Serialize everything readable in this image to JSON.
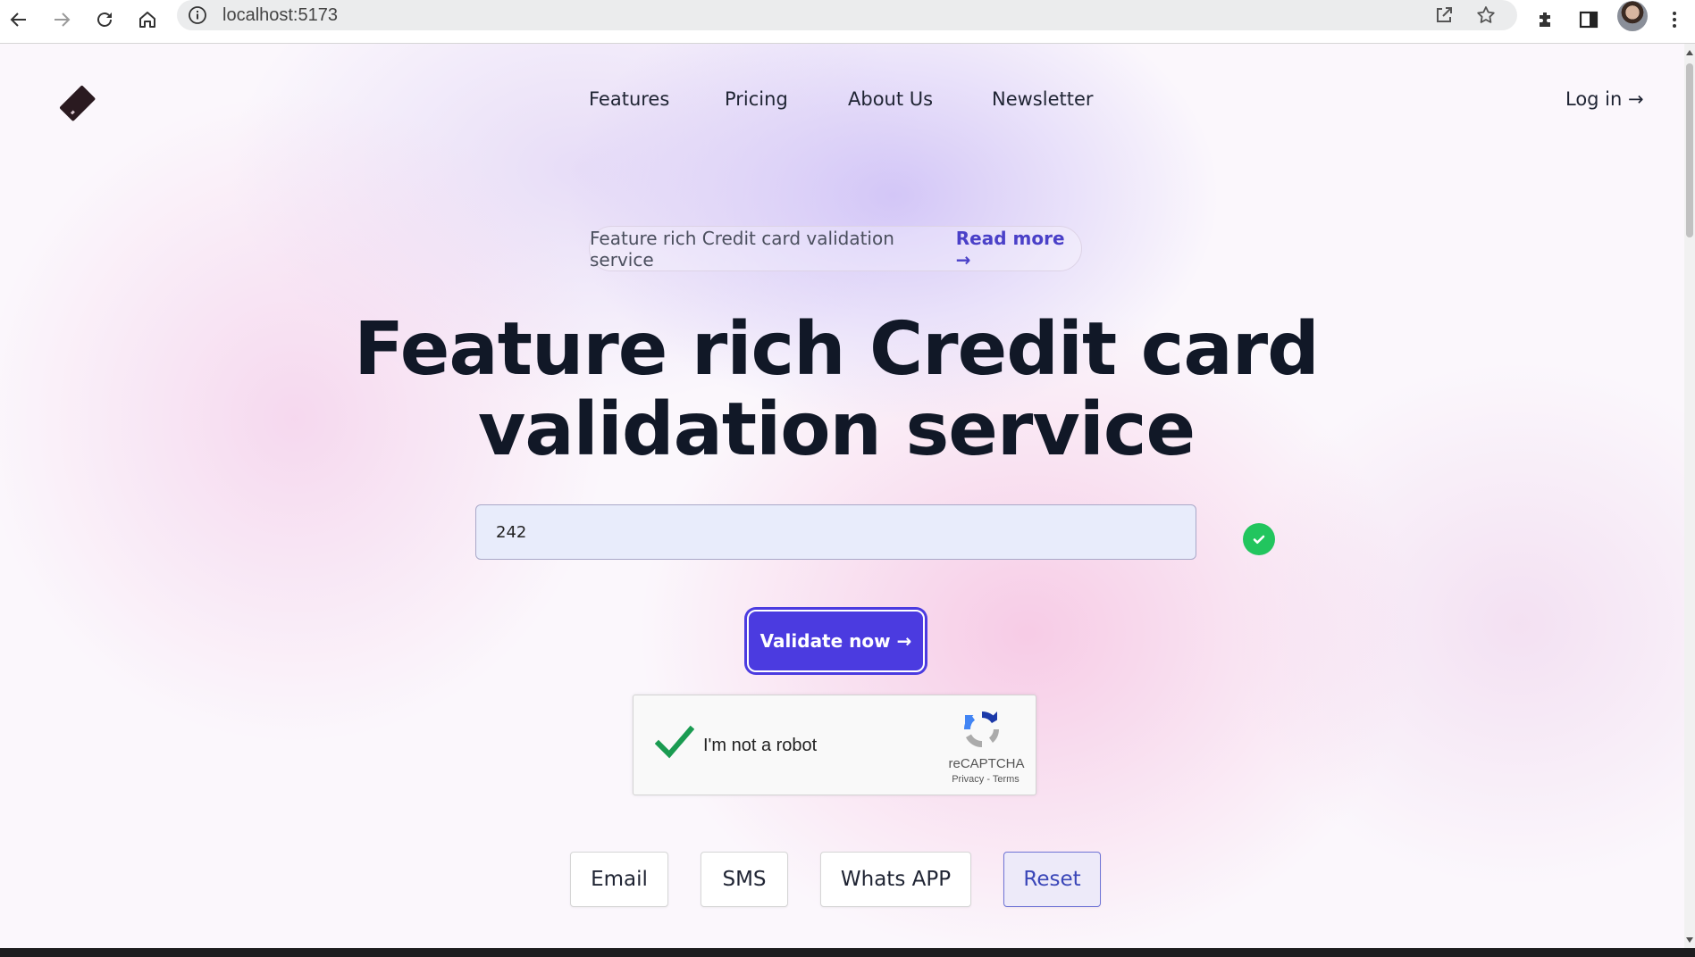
{
  "browser": {
    "url": "localhost:5173",
    "icons": [
      "back-arrow-icon",
      "forward-arrow-icon",
      "reload-icon",
      "home-icon",
      "info-icon",
      "share-icon",
      "star-icon",
      "extensions-icon",
      "side-panel-icon",
      "avatar",
      "kebab-menu-icon"
    ]
  },
  "nav": {
    "items": [
      "Features",
      "Pricing",
      "About Us",
      "Newsletter"
    ],
    "login": "Log in →"
  },
  "announcement": {
    "text": "Feature rich Credit card validation service",
    "link": "Read more →"
  },
  "hero": {
    "line1": "Feature rich Credit card",
    "line2": "validation service"
  },
  "card_input": {
    "value": "242"
  },
  "validate_button": "Validate now →",
  "recaptcha": {
    "label": "I'm not a robot",
    "brand": "reCAPTCHA",
    "privacy": "Privacy",
    "separator": " - ",
    "terms": "Terms",
    "checked": true
  },
  "actions": {
    "email": "Email",
    "sms": "SMS",
    "whatsapp": "Whats APP",
    "reset": "Reset"
  },
  "colors": {
    "accent": "#4b3be0",
    "success": "#22c55e",
    "heading": "#111827"
  }
}
